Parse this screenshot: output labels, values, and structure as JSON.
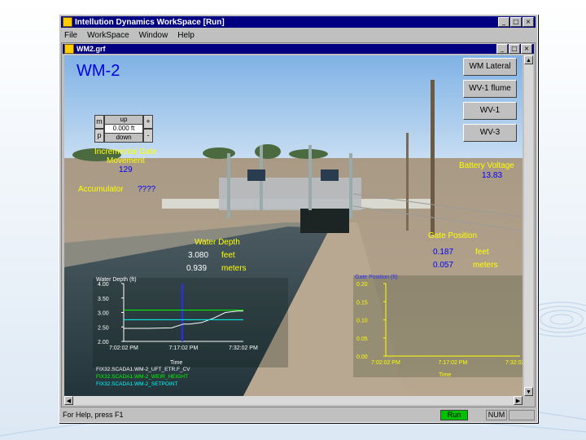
{
  "window": {
    "title": "Intellution Dynamics WorkSpace [Run]",
    "menu": [
      "File",
      "WorkSpace",
      "Window",
      "Help"
    ],
    "buttons": [
      "_",
      "□",
      "×"
    ]
  },
  "child": {
    "title": "WM2.grf",
    "buttons": [
      "_",
      "□",
      "×"
    ]
  },
  "station": "WM-2",
  "nav_buttons": [
    "WM Lateral",
    "WV-1 flume",
    "WV-1",
    "WV-3"
  ],
  "gate_control": {
    "m": "m",
    "p": "p",
    "up": "up",
    "down": "down",
    "value": "0.000 ft",
    "k1": "+",
    "k2": "-"
  },
  "incremental": {
    "label_line1": "Incremental Gate",
    "label_line2": "Movement",
    "value": "129"
  },
  "accumulator": {
    "label": "Accumulator",
    "value": "????"
  },
  "battery": {
    "label": "Battery Voltage",
    "value": "13.83"
  },
  "water_depth": {
    "label": "Water Depth",
    "feet_value": "3.080",
    "feet_unit": "feet",
    "meters_value": "0.939",
    "meters_unit": "meters"
  },
  "gate_position": {
    "label": "Gate Position",
    "feet_value": "0.187",
    "feet_unit": "feet",
    "meters_value": "0.057",
    "meters_unit": "meters"
  },
  "chart_left": {
    "title": "Water Depth (ft)",
    "yticks": [
      "4.00",
      "3.50",
      "3.00",
      "2.50",
      "2.00"
    ],
    "xticks": [
      "7:02:02 PM",
      "7:17:02 PM",
      "7:32:02 PM"
    ],
    "xlabel": "Time",
    "legend": [
      "FIX32.SCADA1.WM-2_UFT_ETR.F_CV",
      "FIX32.SCADA1.WM-2_WEIR_HEIGHT",
      "FIX32.SCADA1.WM-2_SETPOINT"
    ],
    "legend_colors": [
      "#ffffff",
      "#00ff00",
      "#00ffff"
    ]
  },
  "chart_right": {
    "title": "Gate Position (ft)",
    "yticks": [
      "0.20",
      "0.15",
      "0.10",
      "0.05",
      "0.00"
    ],
    "xticks": [
      "7:02:02 PM",
      "7:17:02 PM",
      "7:32:02 PM"
    ],
    "xlabel": "Time"
  },
  "status": {
    "help": "For Help, press F1",
    "run": "Run",
    "num": "NUM"
  },
  "chart_data": [
    {
      "type": "line",
      "title": "Water Depth (ft)",
      "xlabel": "Time",
      "ylabel": "",
      "categories": [
        "7:02:02 PM",
        "7:17:02 PM",
        "7:32:02 PM"
      ],
      "ylim": [
        2.0,
        4.0
      ],
      "series": [
        {
          "name": "FIX32.SCADA1.WM-2_UFT_ETR.F_CV",
          "x": [
            0,
            0.2,
            0.4,
            0.5,
            0.55,
            0.65,
            0.75,
            0.85,
            0.95,
            1.0
          ],
          "values": [
            2.45,
            2.45,
            2.47,
            2.6,
            2.6,
            2.65,
            2.8,
            3.0,
            3.05,
            3.05
          ]
        },
        {
          "name": "FIX32.SCADA1.WM-2_WEIR_HEIGHT",
          "x": [
            0,
            1.0
          ],
          "values": [
            3.08,
            3.08
          ]
        },
        {
          "name": "FIX32.SCADA1.WM-2_SETPOINT",
          "x": [
            0,
            1.0
          ],
          "values": [
            2.75,
            2.75
          ]
        }
      ]
    },
    {
      "type": "line",
      "title": "Gate Position (ft)",
      "xlabel": "Time",
      "ylabel": "",
      "categories": [
        "7:02:02 PM",
        "7:17:02 PM",
        "7:32:02 PM"
      ],
      "ylim": [
        0.0,
        0.2
      ],
      "series": []
    }
  ]
}
